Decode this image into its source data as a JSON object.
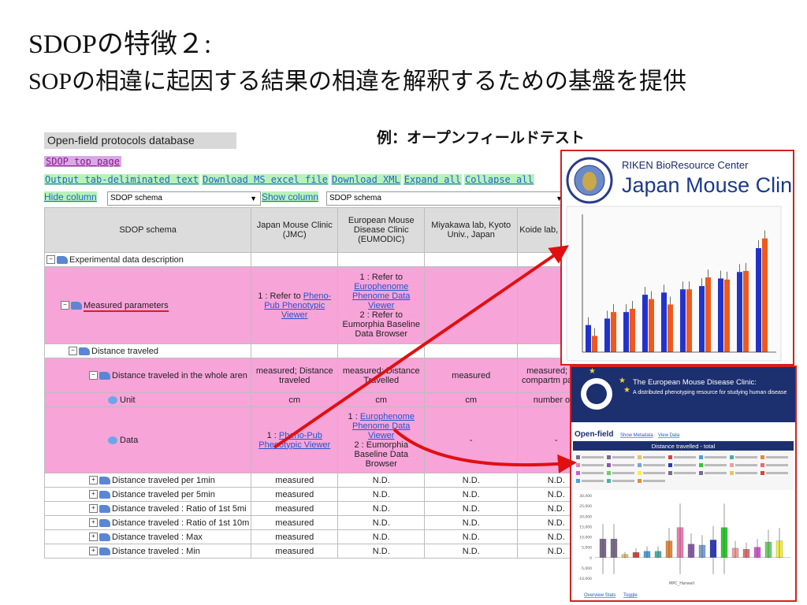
{
  "slide": {
    "title_line1": "SDOPの特徴２:",
    "title_line2": "SOPの相違に起因する結果の相違を解釈するための基盤を提供",
    "example_label": "例：オープンフィールドテスト"
  },
  "database": {
    "title": "Open-field protocols database",
    "top_link": "SDOP top page",
    "links": [
      "Output tab-deliminated text",
      "Download MS excel file",
      "Download XML",
      "Expand all",
      "Collapse all"
    ],
    "hide_column": {
      "label": "Hide column",
      "selected": "SDOP schema"
    },
    "show_column": {
      "label": "Show column",
      "selected": "SDOP schema"
    },
    "headers": [
      "SDOP schema",
      "Japan Mouse Clinic (JMC)",
      "European Mouse Disease Clinic (EUMODIC)",
      "Miyakawa lab, Kyoto Univ., Japan",
      "Koide lab, N Japan"
    ],
    "rows": {
      "r1": {
        "label": "Experimental data description"
      },
      "r2": {
        "label": "Measured parameters",
        "jmc_pre": "1 : Refer to ",
        "jmc_link": "Pheno-Pub Phenotypic Viewer",
        "eu_pre": "1 : Refer to ",
        "eu_link": "Europhenome Phenome Data Viewer",
        "eu_post": "2 : Refer to Eumorphia Baseline Data Browser"
      },
      "r3": {
        "label": "Distance traveled"
      },
      "r4": {
        "label": "Distance traveled in the whole aren",
        "jmc": "measured; Distance traveled",
        "eu": "measured; Distance Travelled",
        "miy": "measured",
        "koide": "measured; N of compartm passed"
      },
      "r5": {
        "label": "Unit",
        "jmc": "cm",
        "eu": "cm",
        "miy": "cm",
        "koide": "number of ti"
      },
      "r6": {
        "label": "Data",
        "jmc_pre": "1 : ",
        "jmc_link": "Pheno-Pub Phenotypic Viewer",
        "eu_pre": "1 : ",
        "eu_link": "Europhenome Phenome Data Viewer",
        "eu_post": "2 : Eumorphia Baseline Data Browser",
        "miy": "-",
        "koide": "-"
      },
      "r7": {
        "label": "Distance traveled per 1min",
        "jmc": "measured",
        "eu": "N.D.",
        "miy": "N.D.",
        "koide": "N.D."
      },
      "r8": {
        "label": "Distance traveled per 5min",
        "jmc": "measured",
        "eu": "N.D.",
        "miy": "N.D.",
        "koide": "N.D."
      },
      "r9": {
        "label": "Distance traveled : Ratio of 1st 5mi",
        "jmc": "measured",
        "eu": "N.D.",
        "miy": "N.D.",
        "koide": "N.D."
      },
      "r10": {
        "label": "Distance traveled : Ratio of 1st 10m",
        "jmc": "measured",
        "eu": "N.D.",
        "miy": "N.D.",
        "koide": "N.D."
      },
      "r11": {
        "label": "Distance traveled : Max",
        "jmc": "measured",
        "eu": "N.D.",
        "miy": "N.D.",
        "koide": "N.D."
      },
      "r12": {
        "label": "Distance traveled : Min",
        "jmc": "measured",
        "eu": "N.D.",
        "miy": "N.D.",
        "koide": "N.D."
      }
    }
  },
  "jmc_panel": {
    "org": "RIKEN BioResource Center",
    "name": "Japan Mouse Clinic",
    "bar_pairs": [
      [
        2500,
        1500
      ],
      [
        3100,
        3700
      ],
      [
        3700,
        4000
      ],
      [
        5300,
        4900
      ],
      [
        5500,
        4400
      ],
      [
        5800,
        5800
      ],
      [
        6100,
        6900
      ],
      [
        6800,
        6700
      ],
      [
        7400,
        7500
      ],
      [
        9600,
        10500
      ]
    ],
    "colors": {
      "blue": "#2233cc",
      "orange": "#ee5a1e"
    }
  },
  "eum_panel": {
    "header": "The European Mouse Disease Clinic:",
    "subheader": "A distributed phenotyping resource for studying human disease",
    "section": "Open-field",
    "show_meta": "Show Metadata",
    "view_data": "View Data",
    "chart_title": "Distance travelled - total",
    "footer_links": [
      "Overview Stats",
      "Toggle"
    ],
    "bars": [
      9,
      9,
      1.5,
      2.5,
      3,
      3,
      8,
      14.5,
      6.5,
      6,
      8.5,
      14.5,
      4.5,
      4,
      5,
      7.5,
      8
    ],
    "bar_colors": [
      "#7a6a8a",
      "#7a6a8a",
      "#e6c26a",
      "#d8443a",
      "#4aa0d8",
      "#4ab0a8",
      "#e38a3a",
      "#f07ab0",
      "#8a5aa8",
      "#7aa0d8",
      "#2a3ab8",
      "#2acc2a",
      "#f0a0a0",
      "#e07070",
      "#d05ad0",
      "#6ad06a",
      "#f4f040"
    ],
    "yticks": [
      "30,000",
      "25,000",
      "20,000",
      "15,000",
      "10,000",
      "5,000",
      "0",
      "-5,000",
      "-10,000"
    ],
    "xlabel": "MPC_Harwell"
  }
}
